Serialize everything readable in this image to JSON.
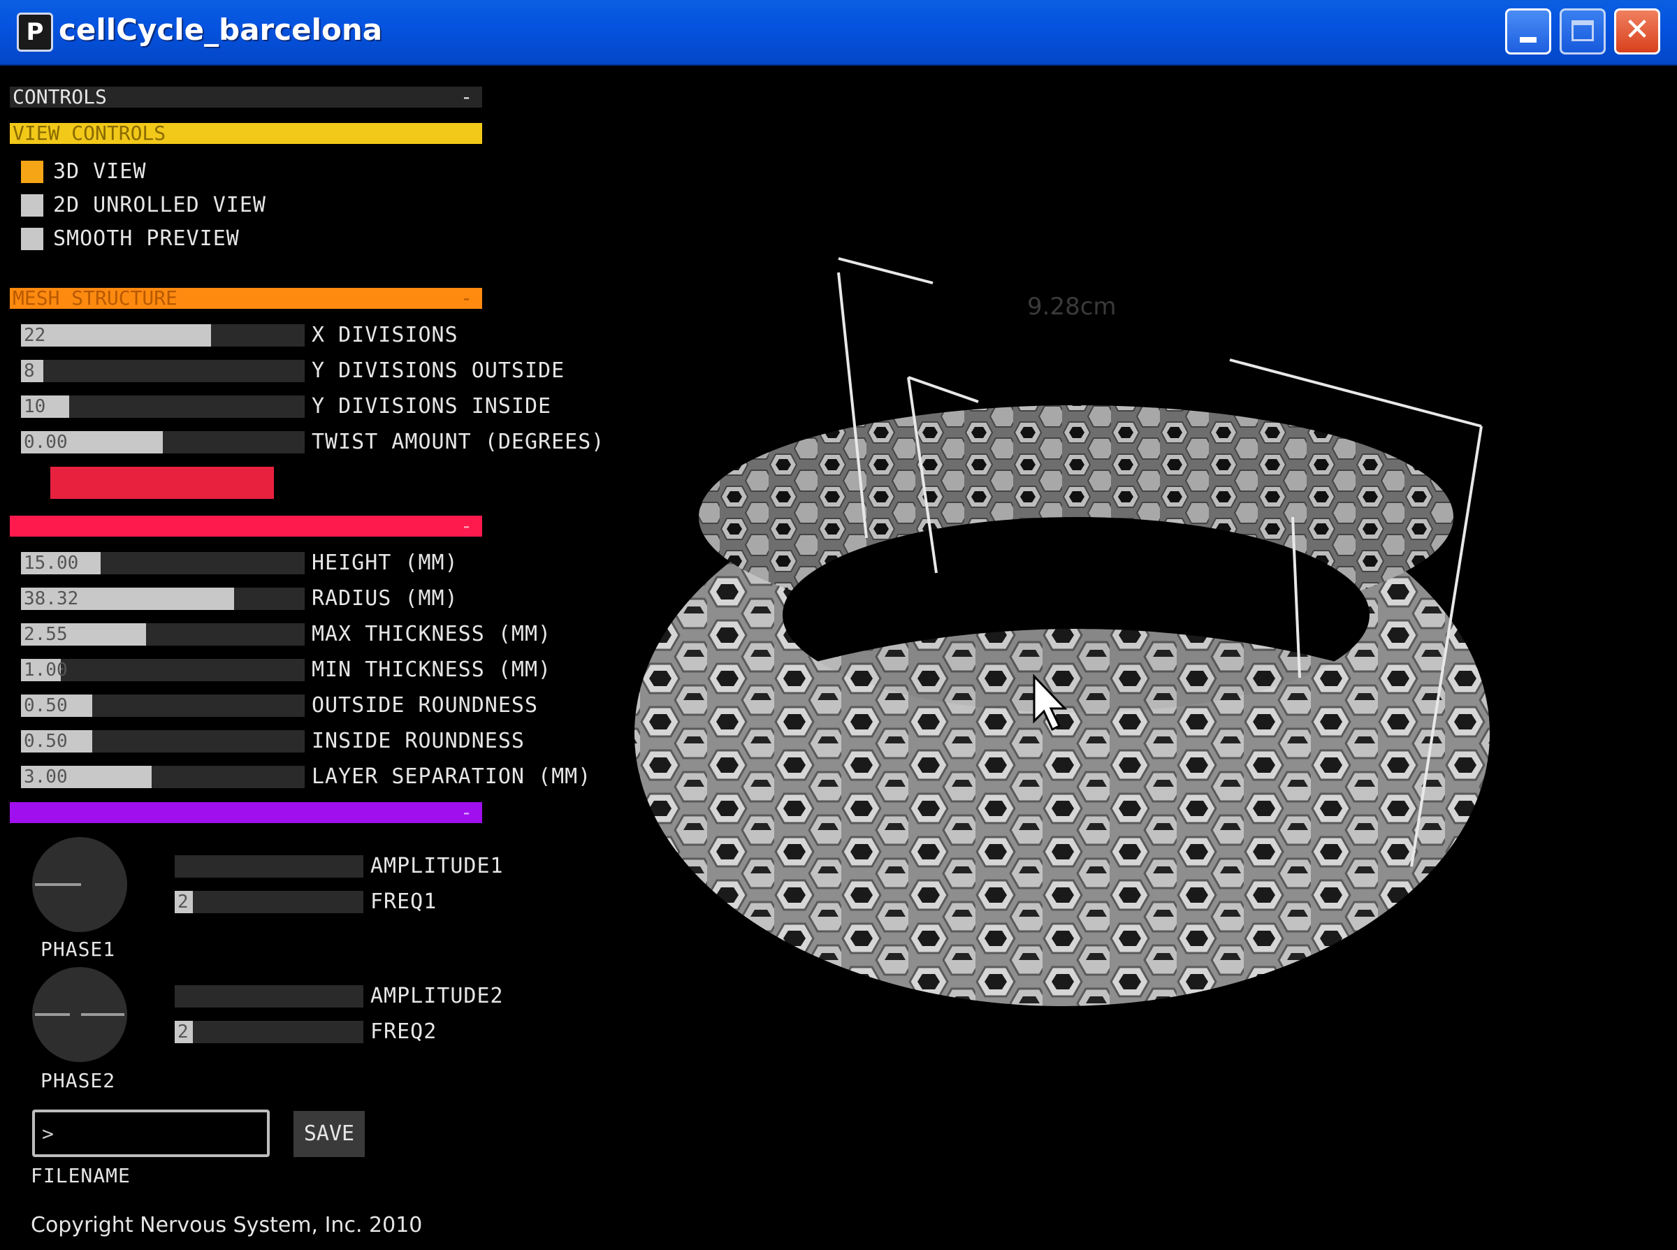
{
  "window": {
    "title": "cellCycle_barcelona",
    "app_icon": "P"
  },
  "controls": {
    "header": "CONTROLS",
    "collapse_symbol": "-",
    "view_controls": {
      "header": "VIEW CONTROLS",
      "color": "#f2c919",
      "options": [
        {
          "label": "3D VIEW",
          "checked": true
        },
        {
          "label": "2D UNROLLED VIEW",
          "checked": false
        },
        {
          "label": "SMOOTH PREVIEW",
          "checked": false
        }
      ]
    },
    "mesh_structure": {
      "header": "MESH STRUCTURE",
      "color": "#ff8a10",
      "sliders": [
        {
          "value": "22",
          "label": "X DIVISIONS",
          "fill": 0.67
        },
        {
          "value": "8",
          "label": "Y DIVISIONS OUTSIDE",
          "fill": 0.08
        },
        {
          "value": "10",
          "label": "Y DIVISIONS INSIDE",
          "fill": 0.17
        },
        {
          "value": "0.00",
          "label": "TWIST AMOUNT (DEGREES)",
          "fill": 0.5
        }
      ],
      "action_button_color": "#e8213f"
    },
    "section_3": {
      "color": "#ff1a4e",
      "sliders": [
        {
          "value": "15.00",
          "label": "HEIGHT (MM)",
          "fill": 0.28
        },
        {
          "value": "38.32",
          "label": "RADIUS (MM)",
          "fill": 0.75
        },
        {
          "value": "2.55",
          "label": "MAX THICKNESS (MM)",
          "fill": 0.44
        },
        {
          "value": "1.00",
          "label": "MIN THICKNESS (MM)",
          "fill": 0.14
        },
        {
          "value": "0.50",
          "label": "OUTSIDE ROUNDNESS",
          "fill": 0.25
        },
        {
          "value": "0.50",
          "label": "INSIDE ROUNDNESS",
          "fill": 0.25
        },
        {
          "value": "3.00",
          "label": "LAYER SEPARATION (MM)",
          "fill": 0.46
        }
      ]
    },
    "section_4": {
      "color": "#a010ee",
      "phase1": {
        "label": "PHASE1",
        "amplitude_label": "AMPLITUDE1",
        "freq_label": "FREQ1",
        "freq_value": "2",
        "amplitude_fill": 0.0
      },
      "phase2": {
        "label": "PHASE2",
        "amplitude_label": "AMPLITUDE2",
        "freq_label": "FREQ2",
        "freq_value": "2",
        "amplitude_fill": 0.0
      }
    },
    "filename": {
      "label": "FILENAME",
      "value": ">"
    },
    "save_label": "SAVE"
  },
  "viewport": {
    "measurement_label": "9.28cm",
    "cursor": "arrow-cursor"
  },
  "copyright": "Copyright Nervous System, Inc. 2010"
}
